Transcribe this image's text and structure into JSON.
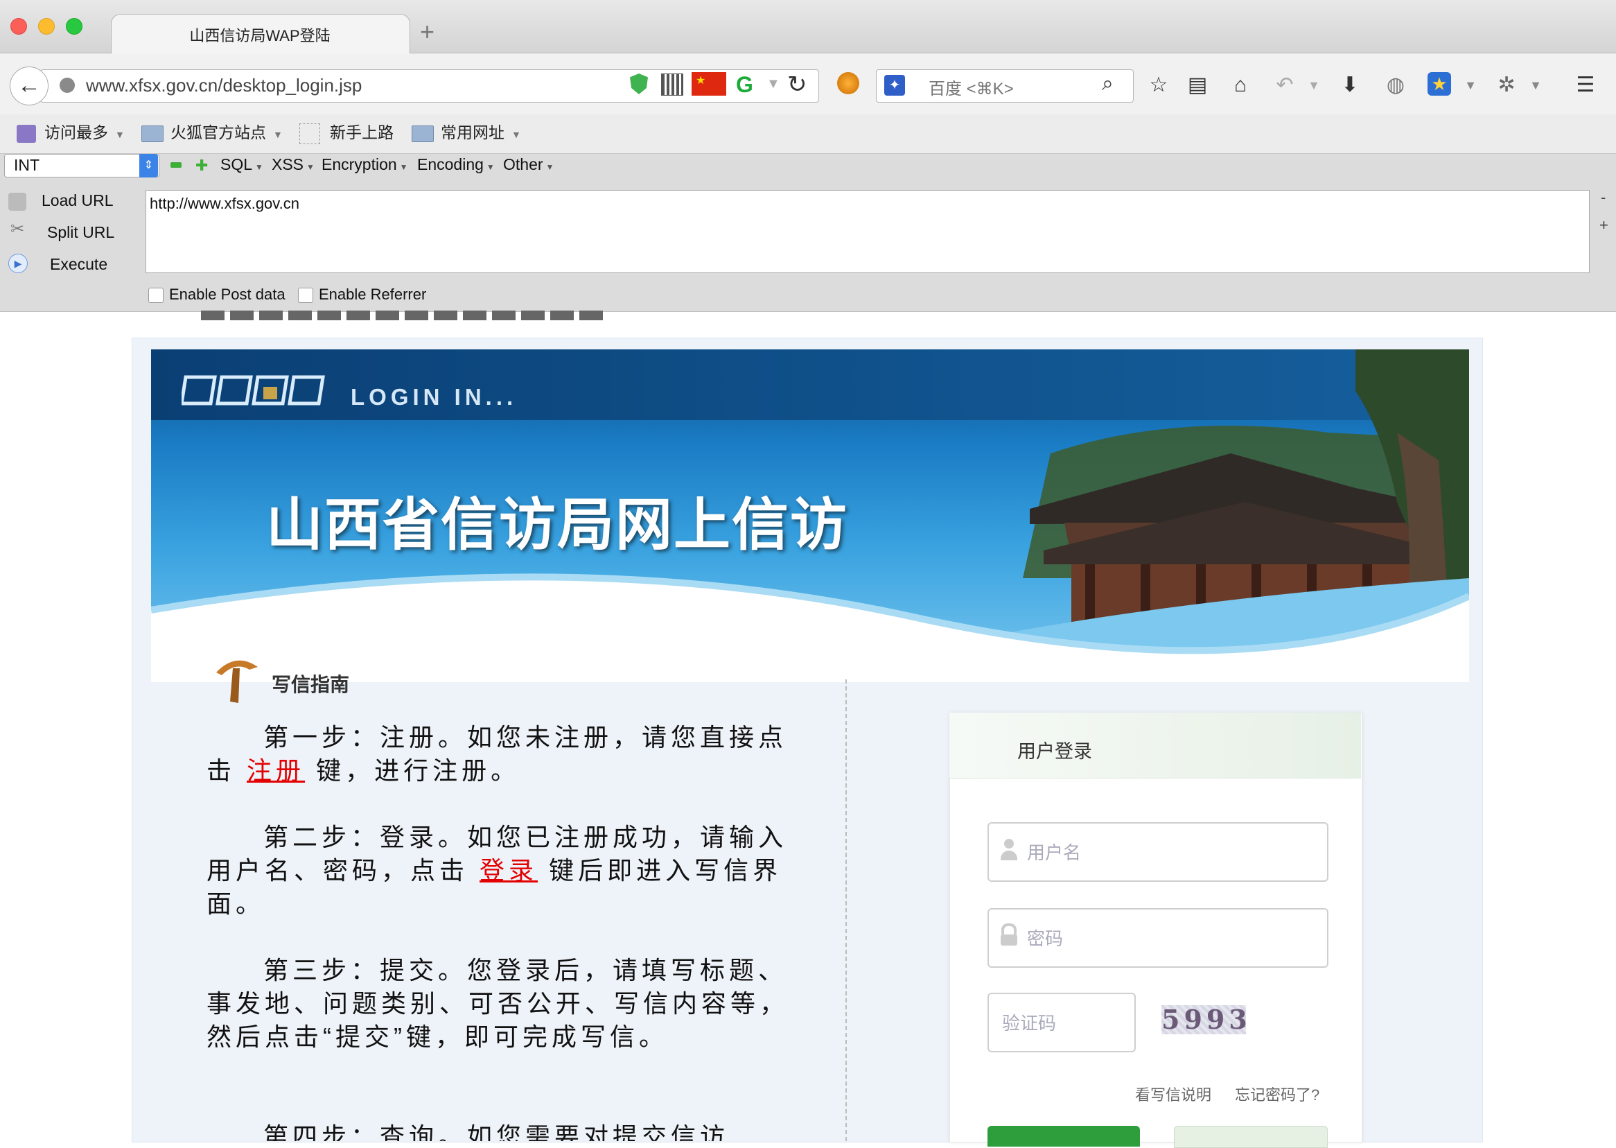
{
  "browser": {
    "tab_title": "山西信访局WAP登陆",
    "new_tab": "+",
    "url": "www.xfsx.gov.cn/desktop_login.jsp",
    "search_placeholder": "百度 <⌘K>"
  },
  "bookmarks": [
    {
      "label": "访问最多"
    },
    {
      "label": "火狐官方站点"
    },
    {
      "label": "新手上路"
    },
    {
      "label": "常用网址"
    }
  ],
  "hackbar": {
    "select_value": "INT",
    "menus": [
      "SQL",
      "XSS",
      "Encryption",
      "Encoding",
      "Other"
    ],
    "buttons": [
      "Load URL",
      "Split URL",
      "Execute"
    ],
    "input_value": "http://www.xfsx.gov.cn",
    "enable_post": "Enable Post data",
    "enable_referrer": "Enable Referrer",
    "side_minus": "-",
    "side_plus": "+"
  },
  "page": {
    "login_in": "LOGIN IN...",
    "site_title": "山西省信访局网上信访",
    "guide_title": "写信指南",
    "step1_a": "第一步：注册。如您未注册，请您直接点击",
    "step1_link": "注册",
    "step1_b": "键，进行注册。",
    "step2_a": "第二步：登录。如您已注册成功，请输入用户名、密码，点击",
    "step2_link": "登录",
    "step2_b": "键后即进入写信界面。",
    "step3": "第三步：提交。您登录后，请填写标题、事发地、问题类别、可否公开、写信内容等，然后点击“提交”键，即可完成写信。",
    "step4": "第四步：查询。如您需要对提交信访",
    "login": {
      "header": "用户登录",
      "username_placeholder": "用户名",
      "password_placeholder": "密码",
      "captcha_placeholder": "验证码",
      "captcha_text": "5993",
      "help_link": "看写信说明",
      "forgot_link": "忘记密码了?"
    }
  },
  "colors": {
    "link_red": "#e30000",
    "login_green": "#2e9e3c",
    "banner_blue": "#1a7cc4"
  }
}
